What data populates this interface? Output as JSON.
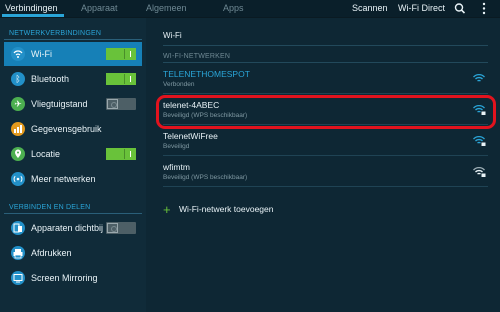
{
  "tabs": [
    {
      "label": "Verbindingen",
      "active": true
    },
    {
      "label": "Apparaat",
      "active": false
    },
    {
      "label": "Algemeen",
      "active": false
    },
    {
      "label": "Apps",
      "active": false
    }
  ],
  "actions": {
    "scan": "Scannen",
    "wifi_direct": "Wi-Fi Direct"
  },
  "colors": {
    "accent": "#2aa5d8",
    "selected": "#1680b7",
    "switch_on": "#69c23a",
    "highlight": "#e1131e"
  },
  "sidebar": {
    "section1": "NETWERKVERBINDINGEN",
    "section2": "VERBINDEN EN DELEN",
    "items": [
      {
        "label": "Wi-Fi",
        "icon": "wifi-icon",
        "switch": "on"
      },
      {
        "label": "Bluetooth",
        "icon": "bluetooth-icon",
        "switch": "on"
      },
      {
        "label": "Vliegtuigstand",
        "icon": "airplane-icon",
        "switch": "off"
      },
      {
        "label": "Gegevensgebruik",
        "icon": "data-usage-icon"
      },
      {
        "label": "Locatie",
        "icon": "location-icon",
        "switch": "on"
      },
      {
        "label": "Meer netwerken",
        "icon": "more-networks-icon"
      },
      {
        "label": "Apparaten dichtbij",
        "icon": "nearby-devices-icon",
        "switch": "off"
      },
      {
        "label": "Afdrukken",
        "icon": "print-icon"
      },
      {
        "label": "Screen Mirroring",
        "icon": "screen-mirroring-icon"
      }
    ]
  },
  "main": {
    "title": "Wi-Fi",
    "networks_header": "WI-FI-NETWERKEN",
    "networks": [
      {
        "name": "TELENETHOMESPOT",
        "status": "Verbonden",
        "connected": true,
        "secured": false
      },
      {
        "name": "telenet-4ABEC",
        "status": "Beveiligd (WPS beschikbaar)",
        "connected": false,
        "secured": true
      },
      {
        "name": "TelenetWiFree",
        "status": "Beveiligd",
        "connected": false,
        "secured": true
      },
      {
        "name": "wfimtm",
        "status": "Beveiligd (WPS beschikbaar)",
        "connected": false,
        "secured": true
      }
    ],
    "add_label": "Wi-Fi-netwerk toevoegen"
  }
}
